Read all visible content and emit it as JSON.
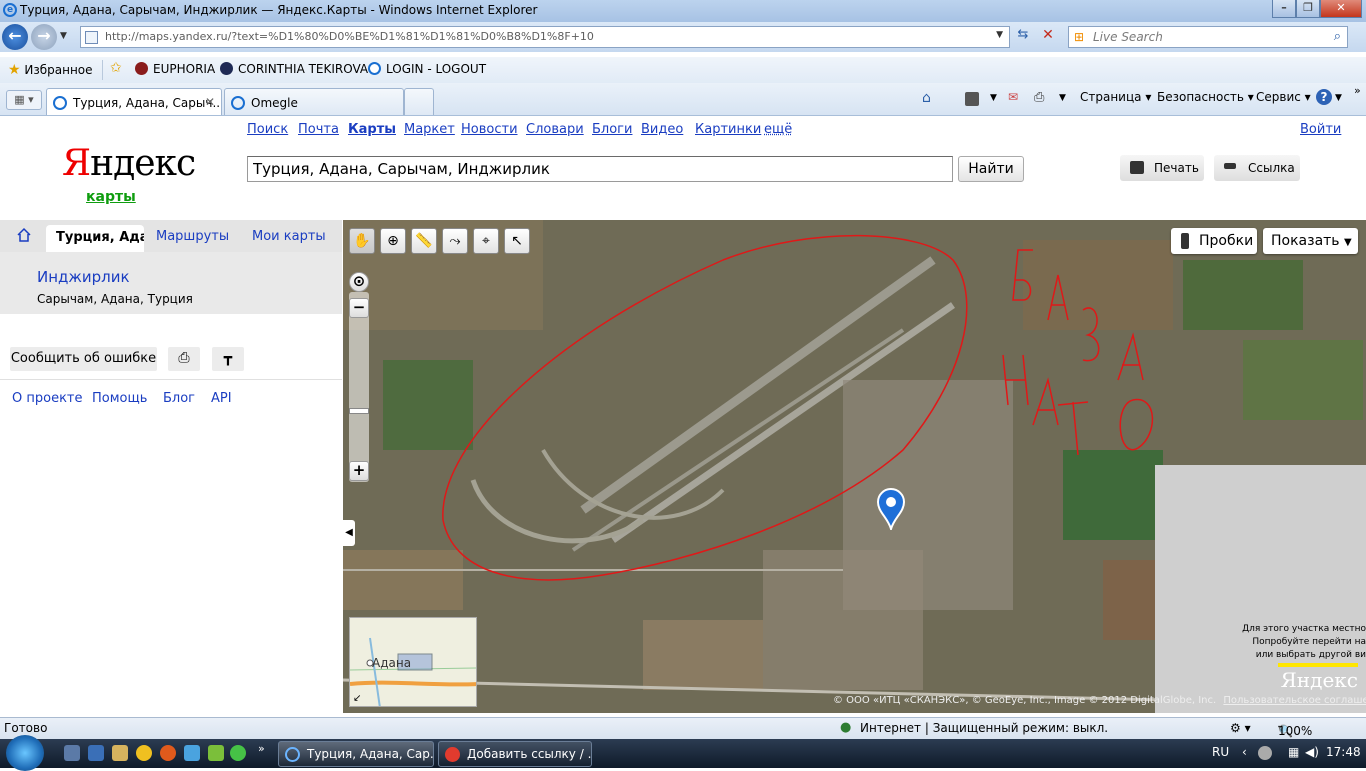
{
  "window": {
    "title": "Турция, Адана, Сарычам, Инджирлик — Яндекс.Карты - Windows Internet Explorer",
    "address": "http://maps.yandex.ru/?text=%D1%80%D0%BE%D1%81%D1%81%D0%B8%D1%8F+10",
    "search_placeholder": "Live Search"
  },
  "favorites": {
    "label": "Избранное",
    "items": [
      "EUPHORIA",
      "CORINTHIA TEKIROVA",
      "LOGIN - LOGOUT"
    ]
  },
  "tabs": [
    {
      "label": "Турция, Адана, Сарыч..."
    },
    {
      "label": "Omegle"
    }
  ],
  "commandbar": {
    "page": "Страница",
    "safety": "Безопасность",
    "tools": "Сервис"
  },
  "yandex": {
    "nav": [
      "Поиск",
      "Почта",
      "Карты",
      "Маркет",
      "Новости",
      "Словари",
      "Блоги",
      "Видео",
      "Картинки",
      "ещё"
    ],
    "login": "Войти",
    "logo_red": "Я",
    "logo_black": "ндекс",
    "logo_sub": "карты",
    "search_value": "Турция, Адана, Сарычам, Инджирлик",
    "search_button": "Найти",
    "print_button": "Печать",
    "link_button": "Ссылка"
  },
  "left_panel": {
    "tabs": [
      "Турция, Адан",
      "Маршруты",
      "Мои карты"
    ],
    "result_title": "Инджирлик",
    "result_address": "Сарычам, Адана, Турция",
    "report_button": "Сообщить об ошибке",
    "footer_links": [
      "О проекте",
      "Помощь",
      "Блог",
      "API"
    ]
  },
  "map": {
    "traffic_button": "Пробки",
    "show_button": "Показать",
    "minimap_label": "Адана",
    "handwriting": "БАЗА НАТО",
    "attribution": "© ООО «ИТЦ «СКАНЭКС», © GeoEye, Inc., Image © 2012 DigitalGlobe, Inc.",
    "agreement": "Пользовательское соглашение",
    "nodata_text": [
      "Для этого участка местно",
      "Попробуйте перейти на",
      "или выбрать другой ви"
    ],
    "logo": "Яндекс"
  },
  "statusbar": {
    "left": "Готово",
    "zone": "Интернет | Защищенный режим: выкл.",
    "zoom": "100%"
  },
  "taskbar": {
    "tasks": [
      "Турция, Адана, Сар...",
      "Добавить ссылку / ..."
    ],
    "lang": "RU",
    "time": "17:48"
  },
  "colors": {
    "link": "#1a3dc1",
    "logo_red": "#ee0000",
    "marker": "#1e6fd8",
    "annotation": "#e01818"
  }
}
